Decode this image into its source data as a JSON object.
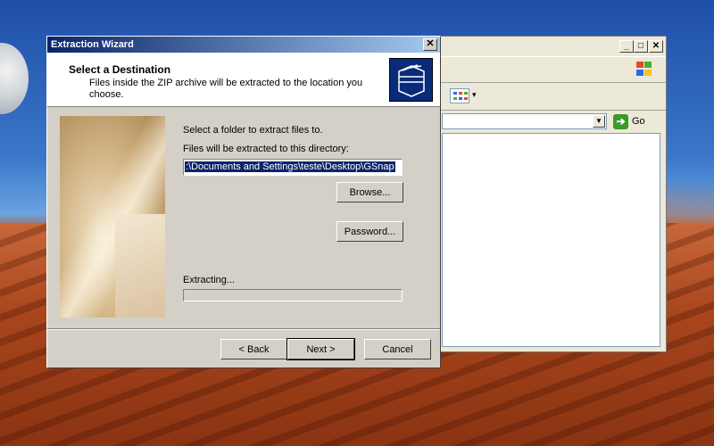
{
  "wizard": {
    "title": "Extraction Wizard",
    "close": "✕",
    "header_title": "Select a Destination",
    "header_subtitle": "Files inside the ZIP archive will be extracted to the location you choose.",
    "select_folder_label": "Select a folder to extract files to.",
    "directory_label": "Files will be extracted to this directory:",
    "path_value": ":\\Documents and Settings\\teste\\Desktop\\GSnap",
    "browse": "Browse...",
    "password": "Password...",
    "extracting_label": "Extracting...",
    "progress": 0,
    "back": "< Back",
    "next": "Next >",
    "cancel": "Cancel"
  },
  "explorer": {
    "minimize": "_",
    "maximize": "□",
    "close": "✕",
    "go": "Go",
    "dropdown": "▼",
    "view_dropdown": "▾"
  },
  "colors": {
    "title_active": "#0a246a",
    "dialog_face": "#d4d0c8",
    "go_green": "#3b9a2b"
  }
}
